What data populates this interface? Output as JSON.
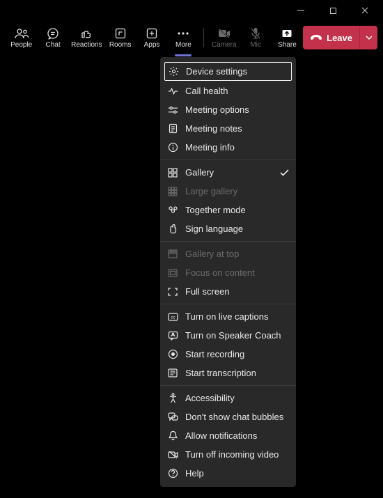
{
  "window": {
    "minimize": "min",
    "maximize": "max",
    "close": "close"
  },
  "toolbar": {
    "people": "People",
    "chat": "Chat",
    "reactions": "Reactions",
    "rooms": "Rooms",
    "apps": "Apps",
    "more": "More",
    "camera": "Camera",
    "mic": "Mic",
    "share": "Share"
  },
  "leave": {
    "label": "Leave"
  },
  "menu": {
    "g1": {
      "device_settings": "Device settings",
      "call_health": "Call health",
      "meeting_options": "Meeting options",
      "meeting_notes": "Meeting notes",
      "meeting_info": "Meeting info"
    },
    "g2": {
      "gallery": "Gallery",
      "large_gallery": "Large gallery",
      "together_mode": "Together mode",
      "sign_language": "Sign language"
    },
    "g3": {
      "gallery_at_top": "Gallery at top",
      "focus_on_content": "Focus on content",
      "full_screen": "Full screen"
    },
    "g4": {
      "live_captions": "Turn on live captions",
      "speaker_coach": "Turn on Speaker Coach",
      "start_recording": "Start recording",
      "start_transcription": "Start transcription"
    },
    "g5": {
      "accessibility": "Accessibility",
      "chat_bubbles": "Don't show chat bubbles",
      "allow_notifications": "Allow notifications",
      "turn_off_video": "Turn off incoming video",
      "help": "Help"
    }
  },
  "colors": {
    "accent": "#7b83eb",
    "leave": "#c4314b",
    "menu_bg": "#292929"
  }
}
